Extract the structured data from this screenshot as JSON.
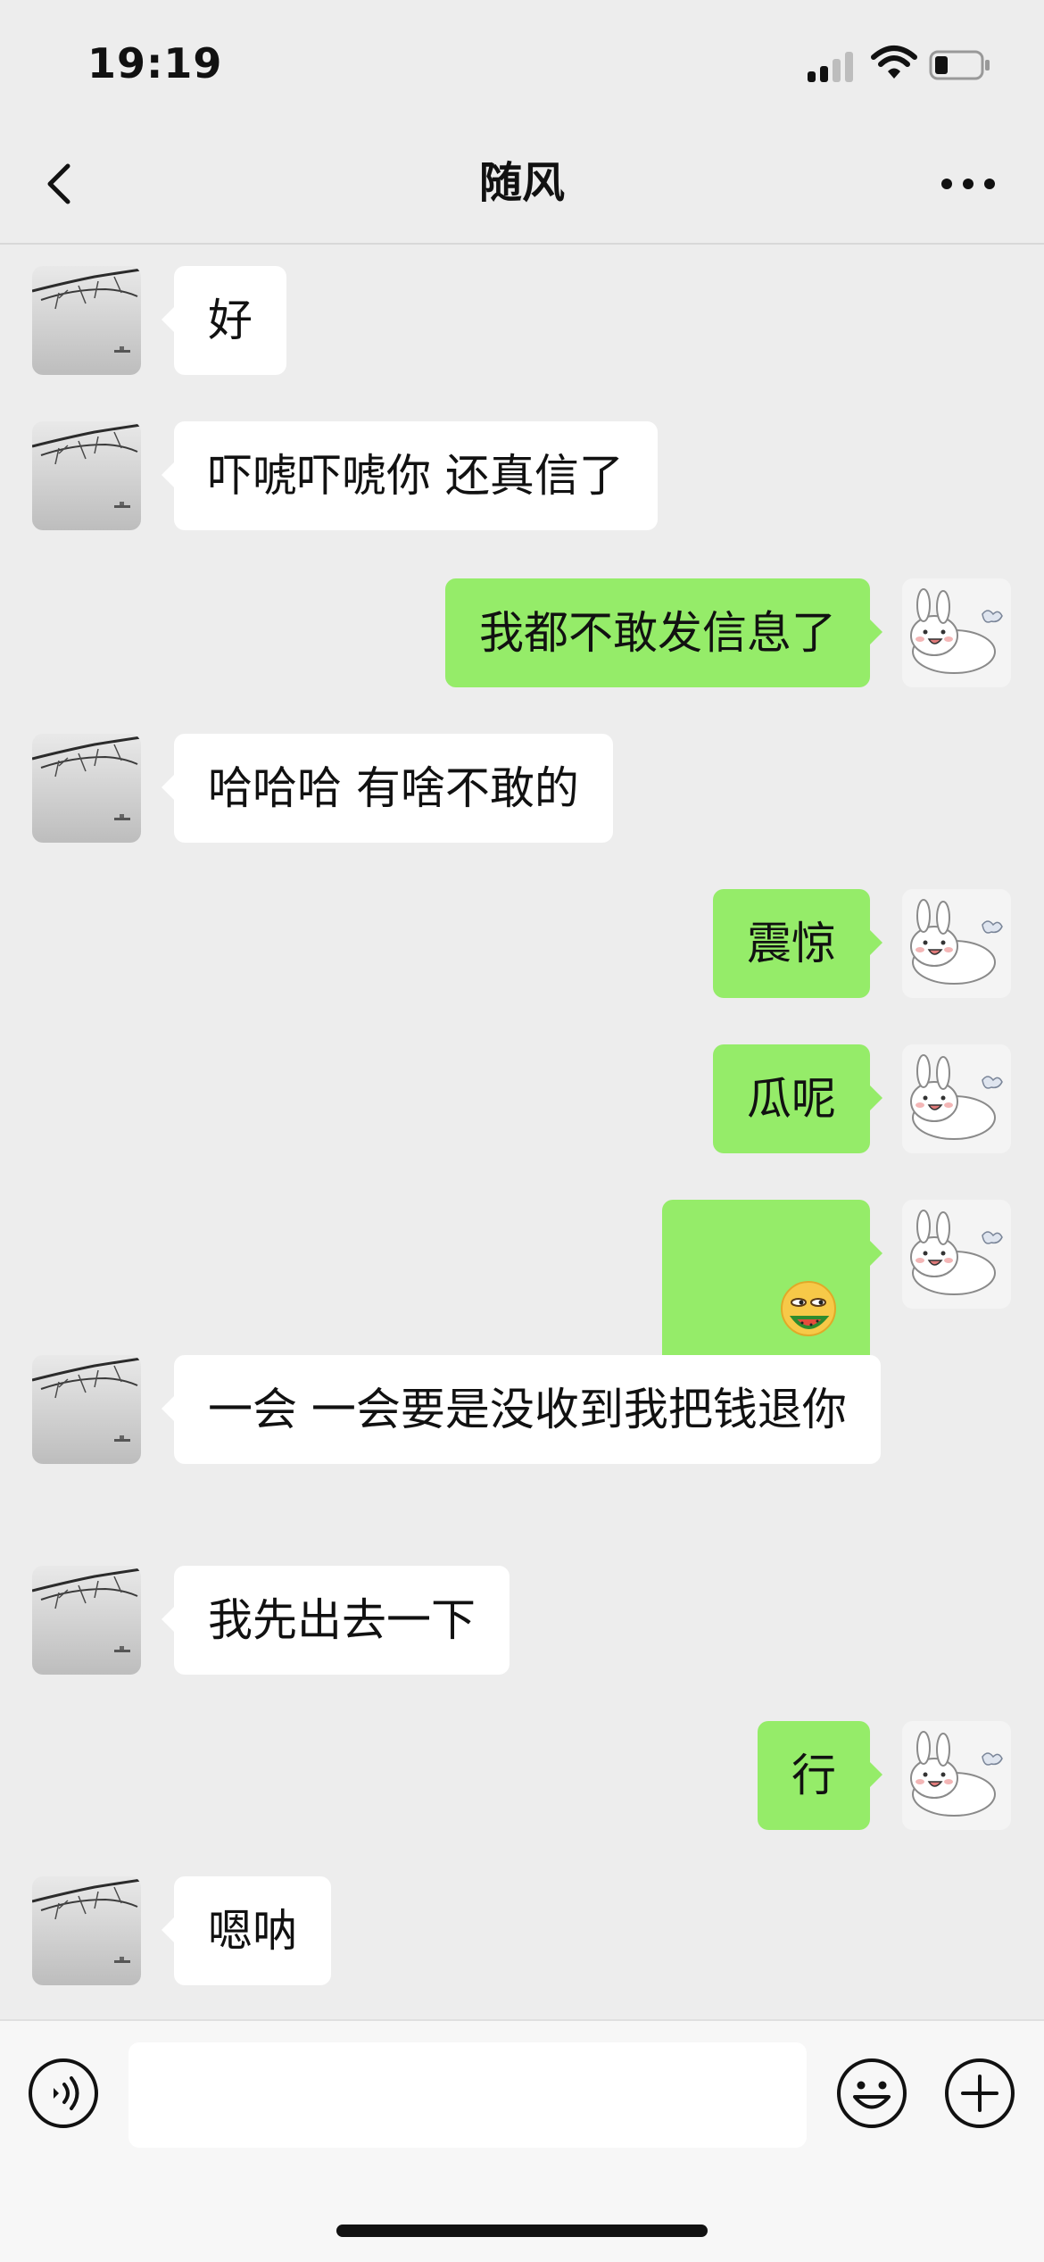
{
  "status_bar": {
    "time": "19:19",
    "signal_bars": 2,
    "battery_level": 0.3
  },
  "nav": {
    "title": "随风",
    "back_icon": "chevron-left-icon",
    "more_icon": "more-dots-icon"
  },
  "messages": [
    {
      "side": "left",
      "text": "好"
    },
    {
      "side": "left",
      "text": "吓唬吓唬你 还真信了"
    },
    {
      "side": "right",
      "text": "我都不敢发信息了"
    },
    {
      "side": "left",
      "text": "哈哈哈 有啥不敢的"
    },
    {
      "side": "right",
      "text": "震惊"
    },
    {
      "side": "right",
      "text": "瓜呢"
    },
    {
      "side": "right",
      "sticker": "eating-melon-emoji-icon"
    },
    {
      "side": "left",
      "text": "一会 一会要是没收到我把钱退你\n"
    },
    {
      "side": "left",
      "text": "我先出去一下"
    },
    {
      "side": "right",
      "text": "行"
    },
    {
      "side": "left",
      "text": "嗯呐"
    }
  ],
  "input_bar": {
    "voice_icon": "voice-icon",
    "input_value": "",
    "emoji_icon": "smiley-icon",
    "plus_icon": "plus-circle-icon"
  },
  "colors": {
    "background": "#ededed",
    "sent_bubble": "#95ec69",
    "received_bubble": "#ffffff"
  }
}
